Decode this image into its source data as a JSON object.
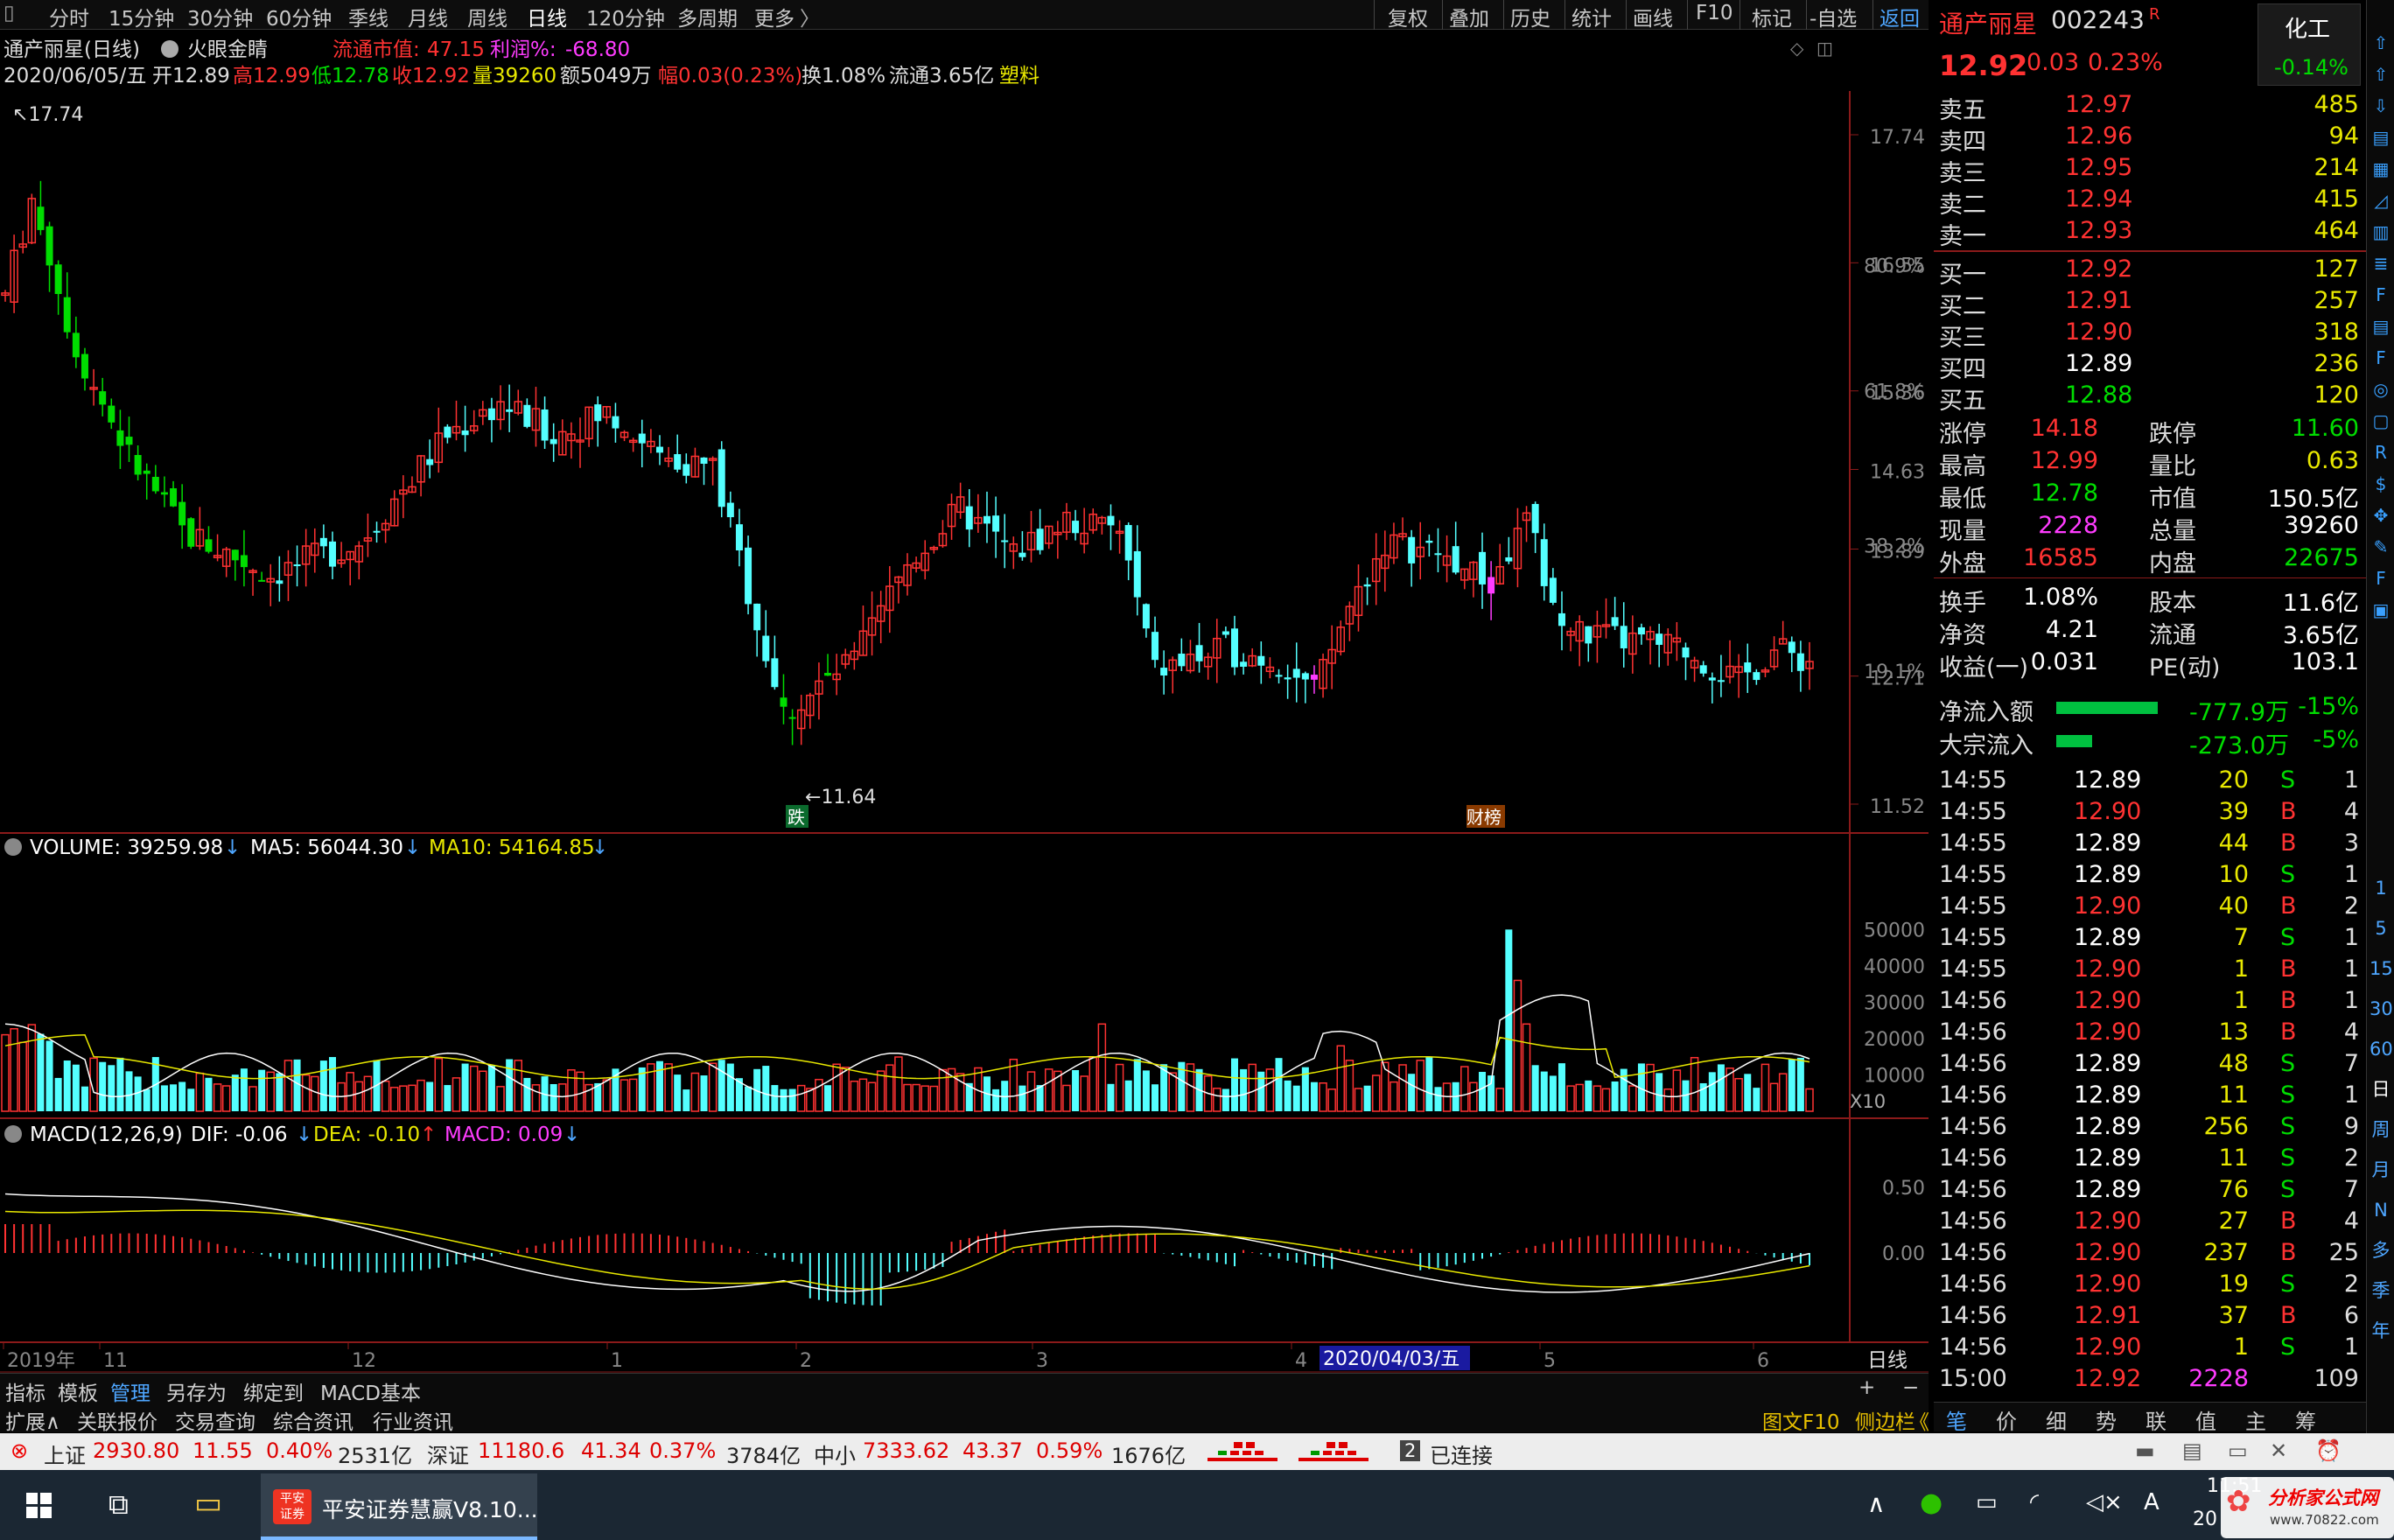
{
  "toolbar": {
    "left": [
      "分时",
      "15分钟",
      "30分钟",
      "60分钟",
      "季线",
      "月线",
      "周线",
      "日线",
      "120分钟",
      "多周期",
      "更多"
    ],
    "right": [
      "复权",
      "叠加",
      "历史",
      "统计",
      "画线",
      "F10",
      "标记",
      "-自选",
      "返回"
    ]
  },
  "title": {
    "stock": "通产丽星(日线)",
    "tool": "火眼金睛",
    "mkt_label": "流通市值:",
    "mkt_value": "47.15",
    "profit_label": "利润%:",
    "profit_value": "-68.80"
  },
  "info": {
    "date": "2020/06/05/五",
    "open": "开12.89",
    "high": "高12.99",
    "low": "低12.78",
    "close": "收12.92",
    "vol": "量39260",
    "amt": "额5049万",
    "chg": "幅0.03(0.23%)",
    "turn": "换1.08%",
    "float": "流通3.65亿",
    "sector": "塑料"
  },
  "kline": {
    "max_label": "17.74",
    "min_label": "11.64",
    "price_axis": [
      "17.74",
      "16.55",
      "15.36",
      "14.63",
      "13.89",
      "12.71",
      "11.52"
    ],
    "pct_axis": [
      "80.9%",
      "61.8%",
      "38.2%",
      "19.1%"
    ],
    "mark_fall": "跌",
    "mark_bill": "财榜"
  },
  "volume": {
    "label": "VOLUME: 39259.98",
    "ma5": "MA5: 56044.30",
    "ma10": "MA10: 54164.85",
    "axis": [
      "50000",
      "40000",
      "30000",
      "20000",
      "10000"
    ],
    "unit": "X10"
  },
  "macd": {
    "label": "MACD(12,26,9)",
    "dif": "DIF: -0.06",
    "dea": "DEA: -0.10",
    "macd": "MACD: 0.09",
    "axis": [
      "0.50",
      "0.00"
    ]
  },
  "dates": {
    "labels": [
      "2019年",
      "11",
      "12",
      "1",
      "2",
      "3",
      "4",
      "5",
      "6"
    ],
    "cursor": "2020/04/03/五",
    "period": "日线"
  },
  "bottom_tabs": [
    "指标",
    "模板",
    "管理",
    "另存为",
    "绑定到",
    "MACD基本"
  ],
  "bottom_tabs2": [
    "扩展∧",
    "关联报价",
    "交易查询",
    "综合资讯",
    "行业资讯"
  ],
  "bottom_right": [
    "图文F10",
    "侧边栏",
    "《"
  ],
  "quote": {
    "name": "通产丽星",
    "code": "002243",
    "flag": "R",
    "price": "12.92",
    "change": "0.03",
    "pct": "0.23%",
    "industry": "化工",
    "ind_pct": "-0.14%"
  },
  "asks": [
    {
      "label": "卖五",
      "price": "12.97",
      "vol": "485"
    },
    {
      "label": "卖四",
      "price": "12.96",
      "vol": "94"
    },
    {
      "label": "卖三",
      "price": "12.95",
      "vol": "214"
    },
    {
      "label": "卖二",
      "price": "12.94",
      "vol": "415"
    },
    {
      "label": "卖一",
      "price": "12.93",
      "vol": "464"
    }
  ],
  "bids": [
    {
      "label": "买一",
      "price": "12.92",
      "vol": "127"
    },
    {
      "label": "买二",
      "price": "12.91",
      "vol": "257"
    },
    {
      "label": "买三",
      "price": "12.90",
      "vol": "318"
    },
    {
      "label": "买四",
      "price": "12.89",
      "vol": "236"
    },
    {
      "label": "买五",
      "price": "12.88",
      "vol": "120"
    }
  ],
  "stats": [
    [
      "涨停",
      "14.18",
      "跌停",
      "11.60"
    ],
    [
      "最高",
      "12.99",
      "量比",
      "0.63"
    ],
    [
      "最低",
      "12.78",
      "市值",
      "150.5亿"
    ],
    [
      "现量",
      "2228",
      "总量",
      "39260"
    ],
    [
      "外盘",
      "16585",
      "内盘",
      "22675"
    ],
    [
      "换手",
      "1.08%",
      "股本",
      "11.6亿"
    ],
    [
      "净资",
      "4.21",
      "流通",
      "3.65亿"
    ],
    [
      "收益(一)",
      "0.031",
      "PE(动)",
      "103.1"
    ]
  ],
  "flow": [
    {
      "label": "净流入额",
      "value": "-777.9万",
      "pct": "-15%",
      "fill": 0.85
    },
    {
      "label": "大宗流入",
      "value": "-273.0万",
      "pct": "-5%",
      "fill": 0.3
    }
  ],
  "ticks": [
    [
      "14:55",
      "12.89",
      "20",
      "S",
      "1"
    ],
    [
      "14:55",
      "12.90",
      "39",
      "B",
      "4"
    ],
    [
      "14:55",
      "12.89",
      "44",
      "B",
      "3"
    ],
    [
      "14:55",
      "12.89",
      "10",
      "S",
      "1"
    ],
    [
      "14:55",
      "12.90",
      "40",
      "B",
      "2"
    ],
    [
      "14:55",
      "12.89",
      "7",
      "S",
      "1"
    ],
    [
      "14:55",
      "12.90",
      "1",
      "B",
      "1"
    ],
    [
      "14:56",
      "12.90",
      "1",
      "B",
      "1"
    ],
    [
      "14:56",
      "12.90",
      "13",
      "B",
      "4"
    ],
    [
      "14:56",
      "12.89",
      "48",
      "S",
      "7"
    ],
    [
      "14:56",
      "12.89",
      "11",
      "S",
      "1"
    ],
    [
      "14:56",
      "12.89",
      "256",
      "S",
      "9"
    ],
    [
      "14:56",
      "12.89",
      "11",
      "S",
      "2"
    ],
    [
      "14:56",
      "12.89",
      "76",
      "S",
      "7"
    ],
    [
      "14:56",
      "12.90",
      "27",
      "B",
      "4"
    ],
    [
      "14:56",
      "12.90",
      "237",
      "B",
      "25"
    ],
    [
      "14:56",
      "12.90",
      "19",
      "S",
      "2"
    ],
    [
      "14:56",
      "12.91",
      "37",
      "B",
      "6"
    ],
    [
      "14:56",
      "12.90",
      "1",
      "S",
      "1"
    ],
    [
      "15:00",
      "12.92",
      "2228",
      "",
      "109"
    ]
  ],
  "rp_tabs": [
    "笔",
    "价",
    "细",
    "势",
    "联",
    "值",
    "主",
    "筹"
  ],
  "side_icons": [
    "up-icon",
    "up-icon",
    "down-icon",
    "doc-icon",
    "grid-icon",
    "chart-icon",
    "kline-icon",
    "list-icon",
    "f10-icon",
    "doc2-icon",
    "f2-icon",
    "circle-icon",
    "square-icon",
    "rsi-icon",
    "money-icon",
    "move-icon",
    "pen-icon",
    "f5-icon",
    "photo-icon"
  ],
  "side_labels": [
    "1",
    "5",
    "15",
    "30",
    "60",
    "日",
    "周",
    "月",
    "N",
    "多",
    "季",
    "年"
  ],
  "status": {
    "sh_label": "上证",
    "sh": "2930.80",
    "sh_chg": "11.55",
    "sh_pct": "0.40%",
    "sh_amt": "2531亿",
    "sz_label": "深证",
    "sz": "11180.6",
    "sz_chg": "41.34",
    "sz_pct": "0.37%",
    "sz_amt": "3784亿",
    "zx_label": "中小",
    "zx": "7333.62",
    "zx_chg": "43.37",
    "zx_pct": "0.59%",
    "zx_amt": "1676亿",
    "num": "2",
    "conn": "已连接"
  },
  "taskbar": {
    "app": "平安证券慧赢V8.10...",
    "time": "11:51",
    "date": "20",
    "watermark": "分析家公式网",
    "wm_url": "www.70822.com"
  },
  "colors": {
    "up": "#ff3232",
    "down": "#54ffff",
    "green": "#00dd00",
    "yellow": "#e8e800",
    "magenta": "#ff3cff",
    "white": "#ffffff"
  }
}
